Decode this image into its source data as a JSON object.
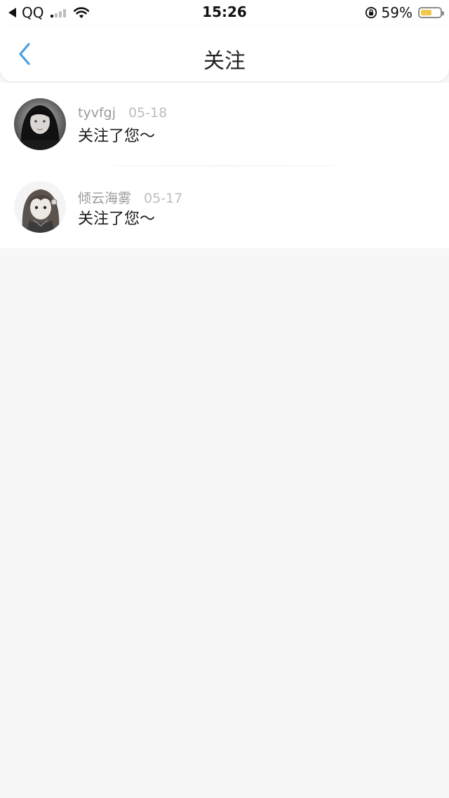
{
  "status_bar": {
    "back_app": "QQ",
    "time": "15:26",
    "battery_percent": "59%",
    "battery_level": 0.59,
    "battery_color": "#f2c94c",
    "icons": [
      "back-triangle-icon",
      "signal-icon",
      "wifi-icon",
      "rotation-lock-icon",
      "battery-icon"
    ]
  },
  "nav": {
    "title": "关注",
    "back_icon": "chevron-left-icon",
    "accent_color": "#4a9fe0"
  },
  "notifications": [
    {
      "username": "tyvfgj",
      "date": "05-18",
      "message": "关注了您～"
    },
    {
      "username": "倾云海雾",
      "date": "05-17",
      "message": "关注了您～"
    }
  ]
}
